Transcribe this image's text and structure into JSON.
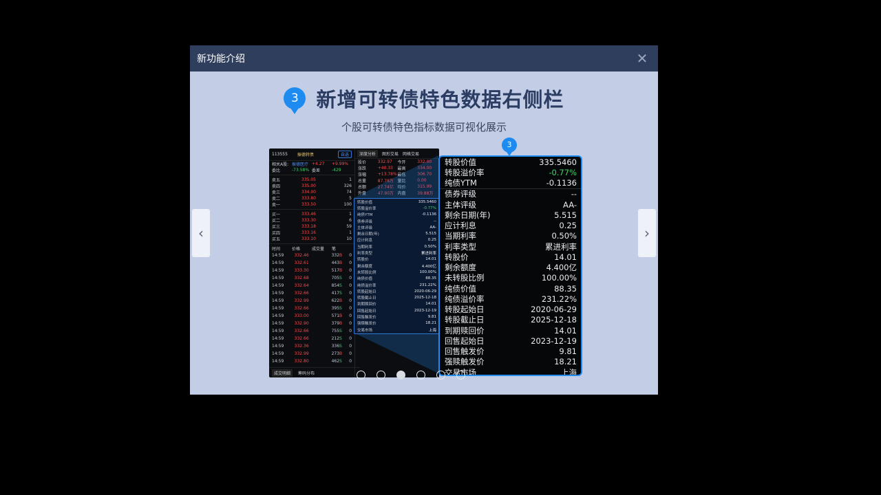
{
  "dialog": {
    "title": "新功能介绍"
  },
  "heading": {
    "badge": "3",
    "text": "新增可转债特色数据右侧栏"
  },
  "subtitle": "个股可转债特色指标数据可视化展示",
  "marker": "3",
  "terminal": {
    "code": "113555",
    "name": "振德转债",
    "tag": "自选",
    "related_label": "相关A股:",
    "related_name": "振德医疗",
    "related_change": "+4.27",
    "related_pct": "+9.99%",
    "ratio_label": "委比",
    "ratio_value": "-73.58%",
    "diff_label": "委差",
    "diff_value": "-429",
    "asks": [
      {
        "label": "卖五",
        "price": "335.05",
        "vol": "1"
      },
      {
        "label": "卖四",
        "price": "335.00",
        "vol": "326"
      },
      {
        "label": "卖三",
        "price": "334.00",
        "vol": "74"
      },
      {
        "label": "卖二",
        "price": "333.80",
        "vol": "5"
      },
      {
        "label": "卖一",
        "price": "333.50",
        "vol": "100"
      }
    ],
    "bids": [
      {
        "label": "买一",
        "price": "333.46",
        "vol": "1"
      },
      {
        "label": "买二",
        "price": "333.30",
        "vol": "6"
      },
      {
        "label": "买三",
        "price": "333.18",
        "vol": "59"
      },
      {
        "label": "买四",
        "price": "333.16",
        "vol": "1"
      },
      {
        "label": "买五",
        "price": "333.10",
        "vol": "10"
      }
    ],
    "trade_headers": [
      "时间",
      "价格",
      "成交量",
      "笔"
    ],
    "trades": [
      [
        "14:59",
        "332.46",
        "332",
        "B",
        "0"
      ],
      [
        "14:59",
        "332.61",
        "443",
        "B",
        "0"
      ],
      [
        "14:59",
        "333.30",
        "517",
        "B",
        "0"
      ],
      [
        "14:59",
        "332.68",
        "705",
        "S",
        "0"
      ],
      [
        "14:59",
        "332.64",
        "854",
        "S",
        "0"
      ],
      [
        "14:59",
        "332.66",
        "417",
        "S",
        "0"
      ],
      [
        "14:59",
        "332.99",
        "622",
        "B",
        "0"
      ],
      [
        "14:59",
        "332.66",
        "395",
        "S",
        "0"
      ],
      [
        "14:59",
        "333.00",
        "571",
        "B",
        "0"
      ],
      [
        "14:59",
        "332.90",
        "379",
        "B",
        "0"
      ],
      [
        "14:59",
        "332.66",
        "755",
        "S",
        "0"
      ],
      [
        "14:59",
        "332.66",
        "212",
        "S",
        "0"
      ],
      [
        "14:59",
        "332.36",
        "336",
        "S",
        "0"
      ],
      [
        "14:59",
        "332.99",
        "273",
        "B",
        "0"
      ],
      [
        "14:59",
        "332.80",
        "462",
        "S",
        "0"
      ]
    ],
    "bottom_tabs": [
      "成交明细",
      "筹码分布"
    ],
    "right_tabs": [
      "深度分析",
      "图形交易",
      "网格交易"
    ],
    "quote": [
      {
        "l1": "股价",
        "v1": "332.97",
        "l2": "今开",
        "v2": "332.00"
      },
      {
        "l1": "涨跌",
        "v1": "+40.33",
        "l2": "最高",
        "v2": "334.00"
      },
      {
        "l1": "涨幅",
        "v1": "+13.78%",
        "l2": "最低",
        "v2": "306.70"
      },
      {
        "l1": "总量",
        "v1": "87.78万",
        "l2": "量比",
        "v2": "0.00"
      },
      {
        "l1": "总额",
        "v1": "27.74亿",
        "l2": "均价",
        "v2": "315.99"
      },
      {
        "l1": "外盘",
        "v1": "47.90万",
        "l2": "内盘",
        "v2": "39.88万"
      }
    ]
  },
  "bond_rows": [
    {
      "label": "转股价值",
      "value": "335.5460",
      "color": "#e9ecf1"
    },
    {
      "label": "转股溢价率",
      "value": "-0.77%",
      "color": "#3fd36a"
    },
    {
      "label": "纯债YTM",
      "value": "-0.1136",
      "color": "#e9ecf1"
    },
    {
      "label": "债券评级",
      "value": "--",
      "color": "#e9ecf1"
    },
    {
      "label": "主体评级",
      "value": "AA-",
      "color": "#e9ecf1"
    },
    {
      "label": "剩余日期(年)",
      "value": "5.515",
      "color": "#e9ecf1"
    },
    {
      "label": "应计利息",
      "value": "0.25",
      "color": "#e9ecf1"
    },
    {
      "label": "当期利率",
      "value": "0.50%",
      "color": "#e9ecf1"
    },
    {
      "label": "利率类型",
      "value": "累进利率",
      "color": "#e9ecf1"
    },
    {
      "label": "转股价",
      "value": "14.01",
      "color": "#e9ecf1"
    },
    {
      "label": "剩余额度",
      "value": "4.400亿",
      "color": "#e9ecf1"
    },
    {
      "label": "未转股比例",
      "value": "100.00%",
      "color": "#e9ecf1"
    },
    {
      "label": "纯债价值",
      "value": "88.35",
      "color": "#e9ecf1"
    },
    {
      "label": "纯债溢价率",
      "value": "231.22%",
      "color": "#e9ecf1"
    },
    {
      "label": "转股起始日",
      "value": "2020-06-29",
      "color": "#e9ecf1"
    },
    {
      "label": "转股截止日",
      "value": "2025-12-18",
      "color": "#e9ecf1"
    },
    {
      "label": "到期赎回价",
      "value": "14.01",
      "color": "#e9ecf1"
    },
    {
      "label": "回售起始日",
      "value": "2023-12-19",
      "color": "#e9ecf1"
    },
    {
      "label": "回售触发价",
      "value": "9.81",
      "color": "#e9ecf1"
    },
    {
      "label": "强赎触发价",
      "value": "18.21",
      "color": "#e9ecf1"
    },
    {
      "label": "交易市场",
      "value": "上海",
      "color": "#e9ecf1"
    }
  ],
  "pagination": {
    "total": 6,
    "active": 2
  }
}
